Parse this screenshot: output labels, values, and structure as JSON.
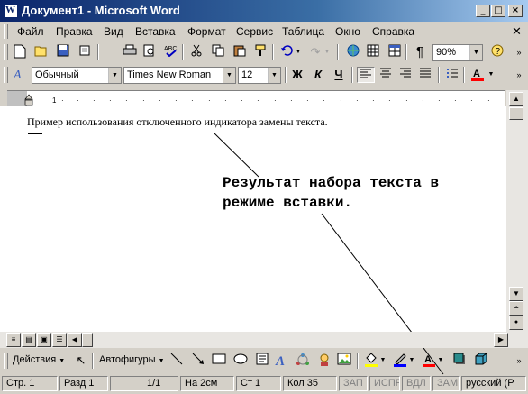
{
  "window": {
    "title": "Документ1 - Microsoft Word",
    "app_icon": "W"
  },
  "caption_buttons": {
    "minimize": "_",
    "maximize": "□",
    "close": "×"
  },
  "menu": [
    "Файл",
    "Правка",
    "Вид",
    "Вставка",
    "Формат",
    "Сервис",
    "Таблица",
    "Окно",
    "Справка"
  ],
  "standard_toolbar": {
    "zoom": "90%"
  },
  "formatting_toolbar": {
    "style": "Обычный",
    "font": "Times New Roman",
    "size": "12",
    "bold": "Ж",
    "italic": "К",
    "underline": "Ч"
  },
  "document": {
    "text": "Пример использования отключенного индикатора замены текста.",
    "callout": "Результат набора текста в\nрежиме вставки."
  },
  "drawing_toolbar": {
    "actions": "Действия",
    "autoshapes": "Автофигуры"
  },
  "status_bar": {
    "page": "Стр. 1",
    "section": "Разд 1",
    "pages": "1/1",
    "at": "На 2см",
    "line": "Ст 1",
    "col": "Кол 35",
    "rec": "ЗАП",
    "trk": "ИСПР",
    "ext": "ВДЛ",
    "ovr": "ЗАМ",
    "lang": "русский (Р"
  },
  "colors": {
    "title_start": "#0a246a",
    "title_end": "#a6caf0",
    "font_color": "#ff0000",
    "highlight": "#ffff00"
  }
}
